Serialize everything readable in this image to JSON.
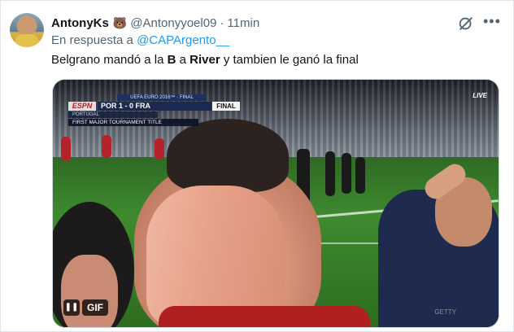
{
  "tweet": {
    "author": {
      "display_name": "AntonyKs",
      "emoji": "🐻",
      "handle": "@Antonyyoel09",
      "separator": "·",
      "time": "11min"
    },
    "reply": {
      "prefix": "En respuesta a",
      "mention": "@CAPArgento__"
    },
    "text": {
      "part1": "Belgrano mandó a la ",
      "bold1": "B",
      "part2": " a ",
      "bold2": "River",
      "part3": " y tambien le ganó la final"
    },
    "icons": {
      "grok": "grok-icon",
      "more": "more-icon"
    }
  },
  "media": {
    "scoreboard": {
      "competition": "UEFA EURO 2016™ · FINAL",
      "broadcaster": "ESPN",
      "score": "POR 1 - 0 FRA",
      "status": "FINAL",
      "team": "PORTUGAL",
      "caption": "FIRST MAJOR TOURNAMENT TITLE"
    },
    "live_logo": "LIVE",
    "pause_symbol": "❚❚",
    "gif_label": "GIF",
    "watermark": "GETTY"
  },
  "colors": {
    "link": "#1d9bf0",
    "secondary_text": "#536471",
    "primary_text": "#0f1419",
    "pitch_green": "#3f8a2f",
    "jersey_red": "#b0201f"
  }
}
